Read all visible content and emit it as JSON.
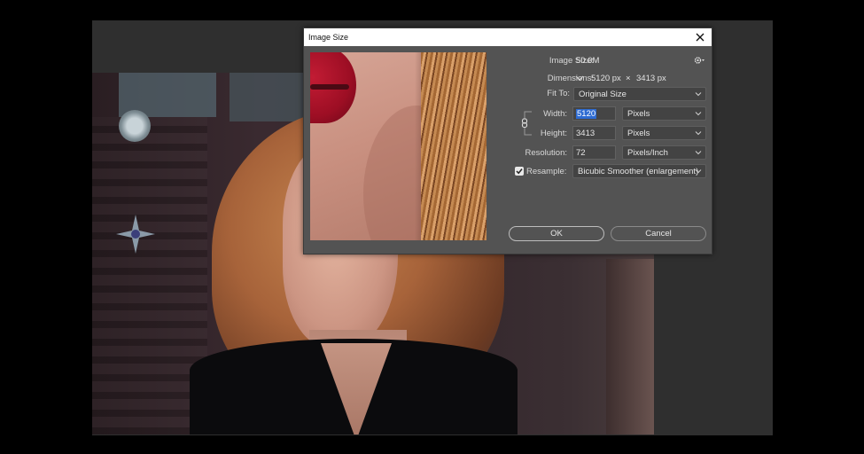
{
  "dialog": {
    "title": "Image Size",
    "image_size_label": "Image Size:",
    "image_size_value": "50.0M",
    "dimensions_label": "Dimensions:",
    "dimensions_width": "5120 px",
    "dimensions_x": "×",
    "dimensions_height": "3413 px",
    "fit_to_label": "Fit To:",
    "fit_to_value": "Original Size",
    "width_label": "Width:",
    "width_value": "5120",
    "width_unit": "Pixels",
    "height_label": "Height:",
    "height_value": "3413",
    "height_unit": "Pixels",
    "resolution_label": "Resolution:",
    "resolution_value": "72",
    "resolution_unit": "Pixels/Inch",
    "resample_label": "Resample:",
    "resample_checked": true,
    "resample_value": "Bicubic Smoother (enlargement)",
    "ok_label": "OK",
    "cancel_label": "Cancel"
  },
  "icons": {
    "close": "close-icon",
    "settings": "gear-icon",
    "link": "chain-link-icon",
    "chevron": "chevron-down-icon",
    "checkmark": "checkmark-icon"
  },
  "colors": {
    "dialog_bg": "#535353",
    "selection": "#2d6bd2",
    "workspace": "#2f2f2f"
  }
}
